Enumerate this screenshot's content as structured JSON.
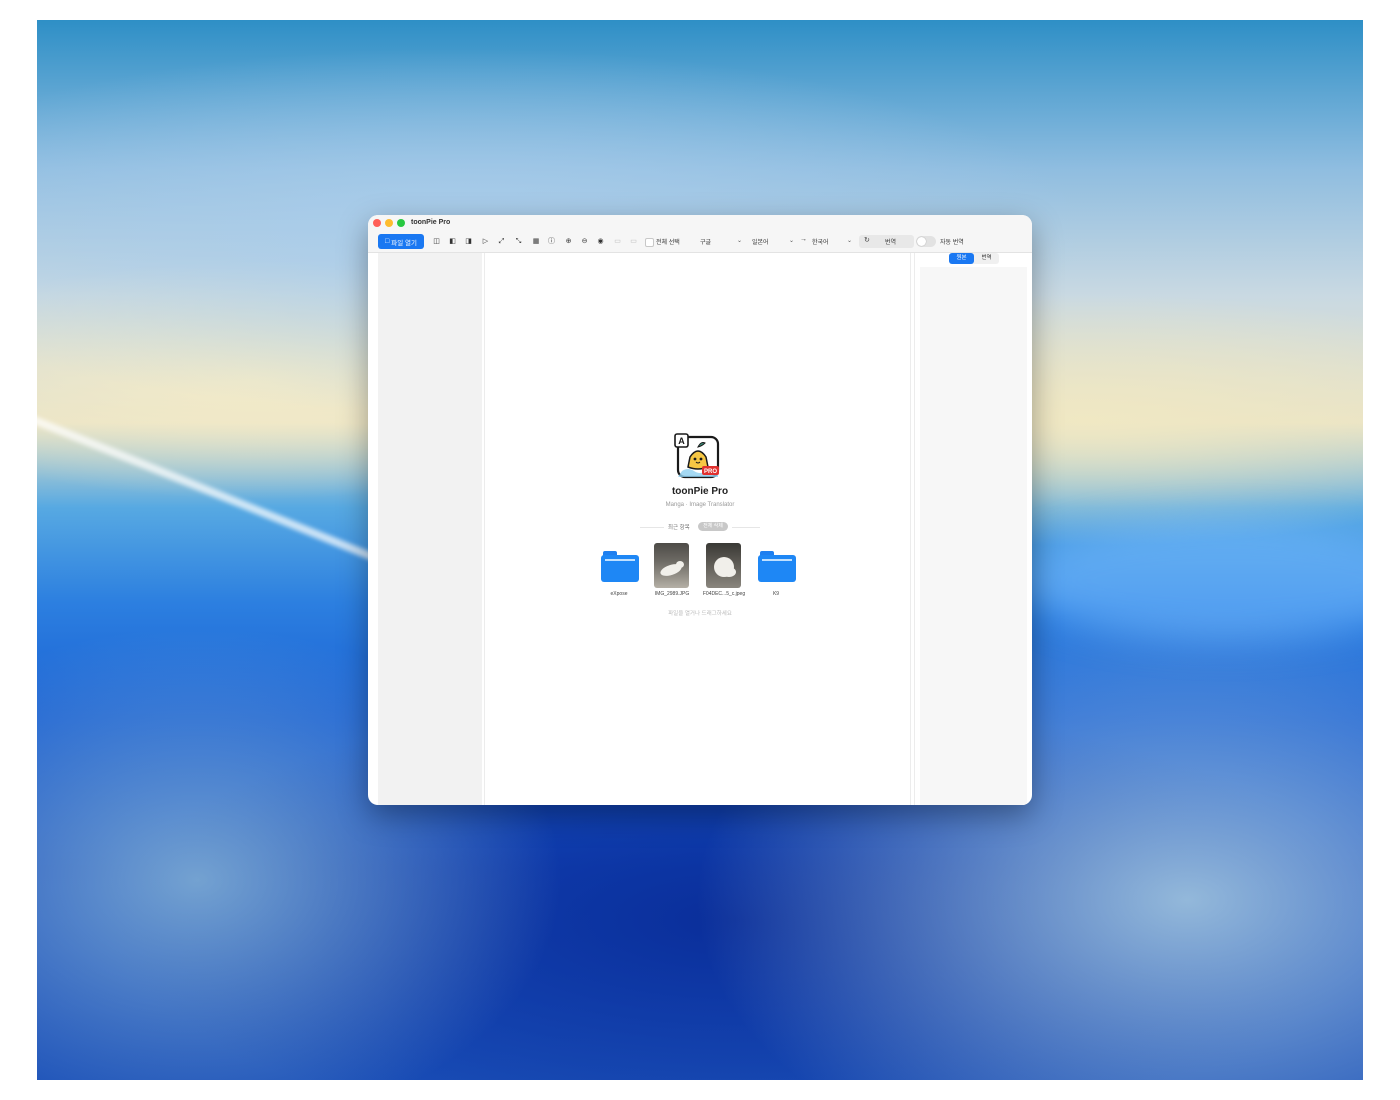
{
  "window": {
    "title": "toonPie Pro"
  },
  "toolbar": {
    "open_file_label": "파일 열기",
    "icons": [
      "split-view-icon",
      "left-page-icon",
      "right-page-icon",
      "play-icon",
      "expand-icon",
      "collapse-icon",
      "filmstrip-icon",
      "info-icon",
      "zoom-in-icon",
      "zoom-out-icon",
      "compass-icon",
      "export-icon",
      "share-icon"
    ],
    "select_all_label": "전체 선택",
    "engine": "구글",
    "source_language": "일본어",
    "arrow": "→",
    "target_language": "한국어",
    "translate_label": "번역",
    "auto_translate_label": "자동 번역",
    "auto_translate_on": false
  },
  "right_panel": {
    "tabs": [
      "원본",
      "번역"
    ],
    "selected_tab": "원본"
  },
  "welcome": {
    "app_name": "toonPie Pro",
    "subtitle": "Manga · Image Translator",
    "recent_label": "최근 항목",
    "clear_all_label": "전체 삭제",
    "items": [
      {
        "name": "eXpose",
        "kind": "folder"
      },
      {
        "name": "IMG_2989.JPG",
        "kind": "image"
      },
      {
        "name": "F04DEC...5_c.jpeg",
        "kind": "image"
      },
      {
        "name": "K9",
        "kind": "folder"
      }
    ],
    "drop_hint": "파일을 열거나 드래그하세요"
  },
  "colors": {
    "accent": "#1a78f2",
    "folder": "#1e87f5",
    "badge": "#e0312f"
  }
}
